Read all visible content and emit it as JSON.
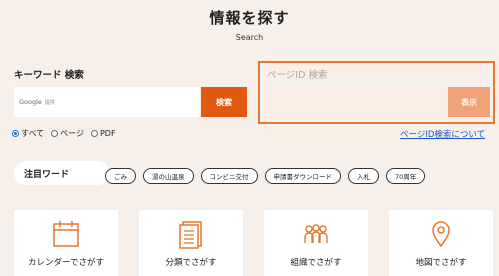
{
  "header": {
    "title": "情報を探す",
    "subtitle": "Search"
  },
  "keyword": {
    "label": "キーワード 検索",
    "google": "Google",
    "google_suffix": "提供",
    "button": "検索"
  },
  "page_id": {
    "label": "ページID 検索",
    "button": "表示",
    "help_link": "ページID検索について"
  },
  "scope": {
    "options": [
      "すべて",
      "ページ",
      "PDF"
    ],
    "selected": "すべて"
  },
  "attention": {
    "label": "注目ワード",
    "tags": [
      "ごみ",
      "湯の山温泉",
      "コンビニ交付",
      "申請書ダウンロード",
      "入札",
      "70周年"
    ]
  },
  "cards": [
    {
      "label": "カレンダーでさがす",
      "icon": "calendar-icon"
    },
    {
      "label": "分類でさがす",
      "icon": "document-list-icon"
    },
    {
      "label": "組織でさがす",
      "icon": "people-icon"
    },
    {
      "label": "地図でさがす",
      "icon": "map-pin-icon"
    }
  ],
  "colors": {
    "accent": "#e25a12",
    "accent_light": "#f1a378",
    "highlight_border": "#e7772f",
    "background": "#f6efea",
    "link": "#1a55c8",
    "icon": "#e7772f"
  }
}
